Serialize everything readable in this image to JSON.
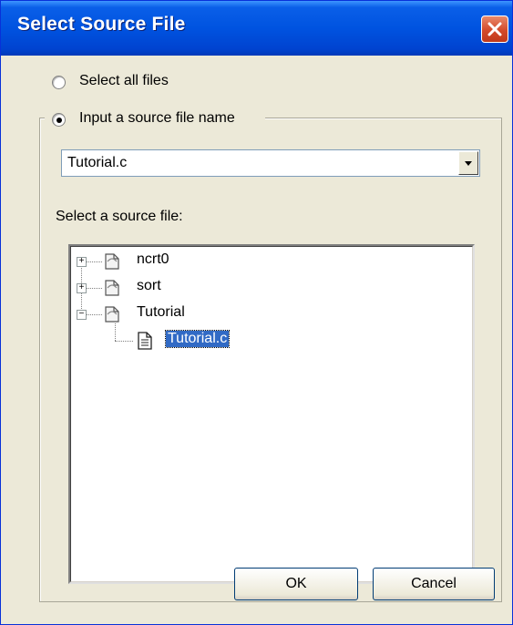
{
  "window": {
    "title": "Select Source File"
  },
  "options": {
    "select_all_label": "Select all files",
    "input_name_label": "Input a source file name",
    "selected": "input_name"
  },
  "source_combo": {
    "value": "Tutorial.c"
  },
  "tree_section": {
    "label": "Select a source file:"
  },
  "tree": {
    "nodes": [
      {
        "label": "ncrt0",
        "expander": "+"
      },
      {
        "label": "sort",
        "expander": "+"
      },
      {
        "label": "Tutorial",
        "expander": "−"
      }
    ],
    "child": {
      "label": "Tutorial.c",
      "selected": true
    }
  },
  "buttons": {
    "ok": "OK",
    "cancel": "Cancel"
  },
  "colors": {
    "titlebar": "#0053e0",
    "selection": "#316ac5",
    "close_button": "#d44a2a"
  }
}
